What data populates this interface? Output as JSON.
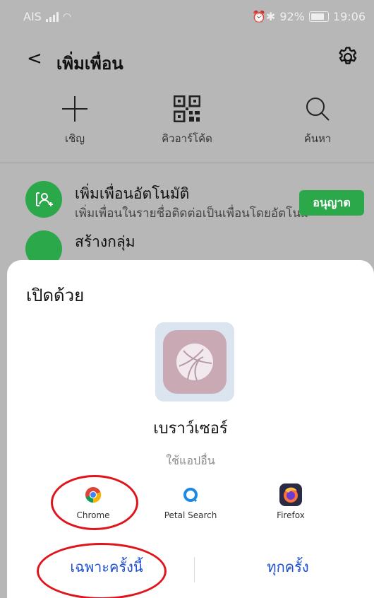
{
  "status_bar": {
    "carrier": "AIS",
    "alarm_bt": "⏰✱",
    "battery_pct": "92%",
    "time": "19:06"
  },
  "header": {
    "back_glyph": "<",
    "title": "เพิ่มเพื่อน"
  },
  "actions": [
    {
      "label": "เชิญ",
      "icon": "plus-icon"
    },
    {
      "label": "คิวอาร์โค้ด",
      "icon": "qr-code-icon"
    },
    {
      "label": "ค้นหา",
      "icon": "search-icon"
    }
  ],
  "list": [
    {
      "title": "เพิ่มเพื่อนอัตโนมัติ",
      "subtitle": "เพิ่มเพื่อนในรายชื่อติดต่อเป็นเพื่อนโดยอัตโนมั",
      "button": "อนุญาต"
    },
    {
      "title": "สร้างกลุ่ม"
    }
  ],
  "sheet": {
    "title": "เปิดด้วย",
    "default_app_name": "เบราว์เซอร์",
    "other_apps_label": "ใช้แอปอื่น",
    "apps": [
      {
        "name": "Chrome",
        "icon": "chrome-icon"
      },
      {
        "name": "Petal Search",
        "icon": "petal-search-icon"
      },
      {
        "name": "Firefox",
        "icon": "firefox-icon"
      }
    ],
    "just_once": "เฉพาะครั้งนี้",
    "always": "ทุกครั้ง"
  },
  "colors": {
    "accent_green": "#2aa84a",
    "link_blue": "#1f4fd1",
    "highlight_red": "#e0151b"
  }
}
